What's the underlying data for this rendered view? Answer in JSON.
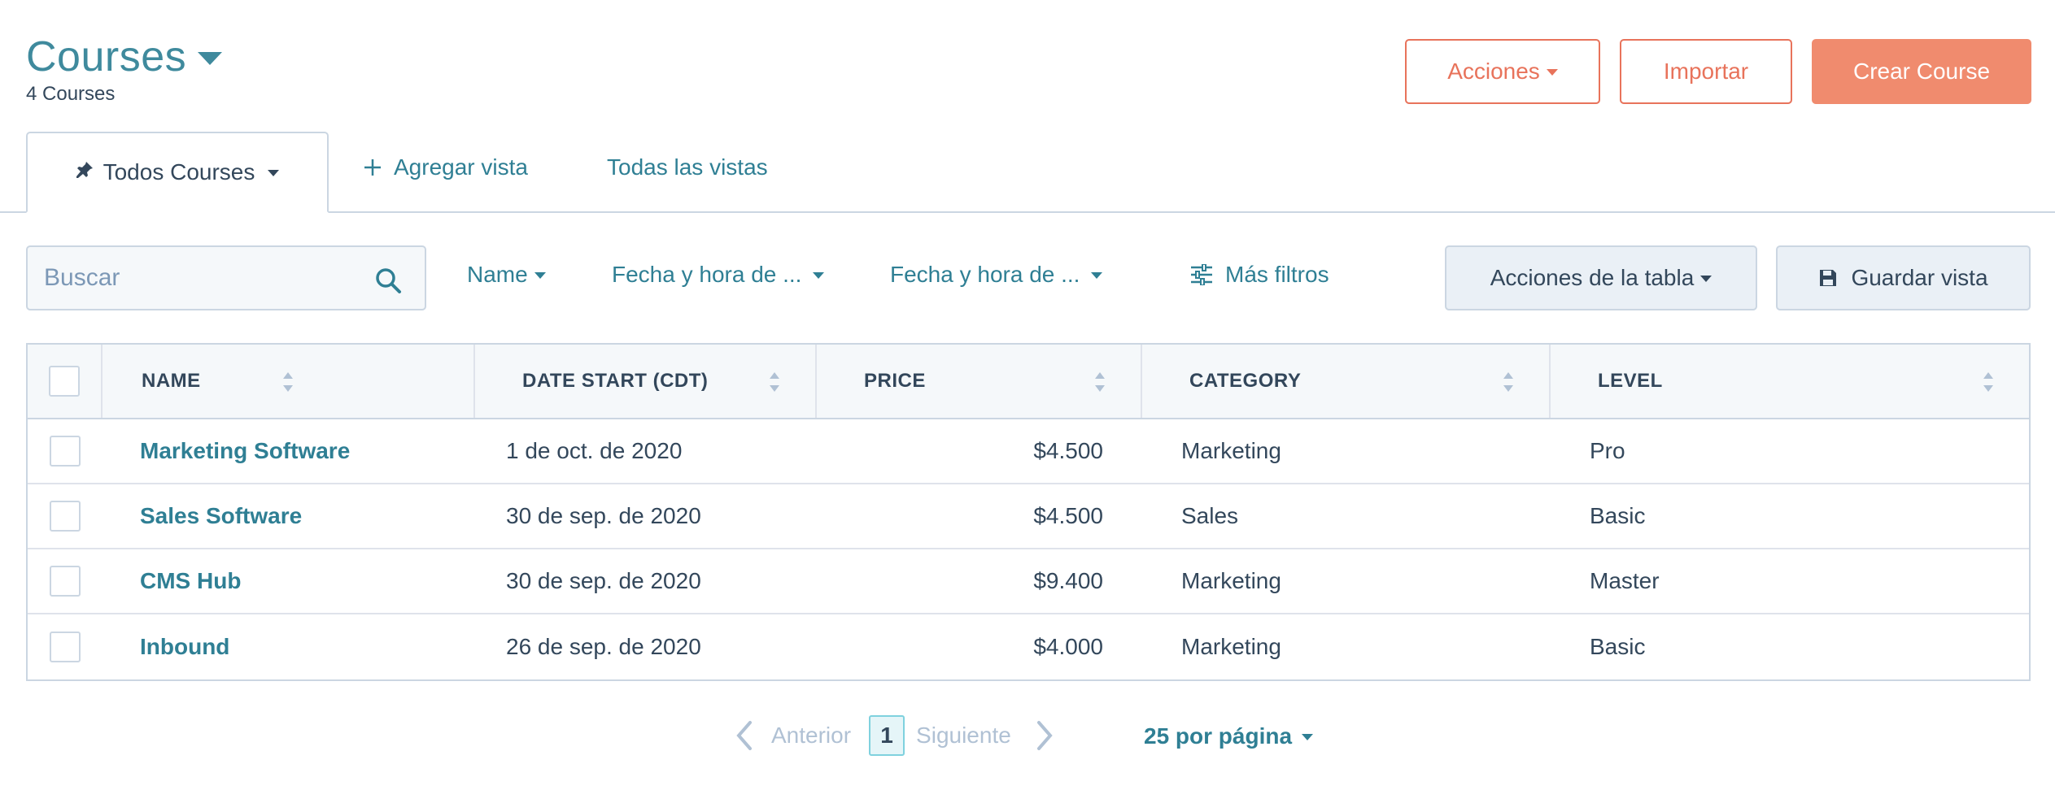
{
  "header": {
    "title": "Courses",
    "subtitle": "4 Courses",
    "actions_label": "Acciones",
    "import_label": "Importar",
    "create_label": "Crear Course"
  },
  "tabs": {
    "active_label": "Todos Courses",
    "add_view_label": "Agregar vista",
    "all_views_label": "Todas las vistas"
  },
  "filters": {
    "search_placeholder": "Buscar",
    "name_label": "Name",
    "date1_label": "Fecha y hora de ...",
    "date2_label": "Fecha y hora de ...",
    "more_filters_label": "Más filtros",
    "table_actions_label": "Acciones de la tabla",
    "save_view_label": "Guardar vista"
  },
  "table": {
    "columns": [
      "NAME",
      "DATE START (CDT)",
      "PRICE",
      "CATEGORY",
      "LEVEL"
    ],
    "rows": [
      {
        "name": "Marketing Software",
        "date": "1 de oct. de 2020",
        "price": "$4.500",
        "category": "Marketing",
        "level": "Pro"
      },
      {
        "name": "Sales Software",
        "date": "30 de sep. de 2020",
        "price": "$4.500",
        "category": "Sales",
        "level": "Basic"
      },
      {
        "name": "CMS Hub",
        "date": "30 de sep. de 2020",
        "price": "$9.400",
        "category": "Marketing",
        "level": "Master"
      },
      {
        "name": "Inbound",
        "date": "26 de sep. de 2020",
        "price": "$4.000",
        "category": "Marketing",
        "level": "Basic"
      }
    ]
  },
  "pagination": {
    "prev_label": "Anterior",
    "current_page": "1",
    "next_label": "Siguiente",
    "per_page_label": "25 por página"
  },
  "colors": {
    "accent": "#2f7f94",
    "brand": "#f08b6e",
    "border": "#cbd6e2"
  }
}
